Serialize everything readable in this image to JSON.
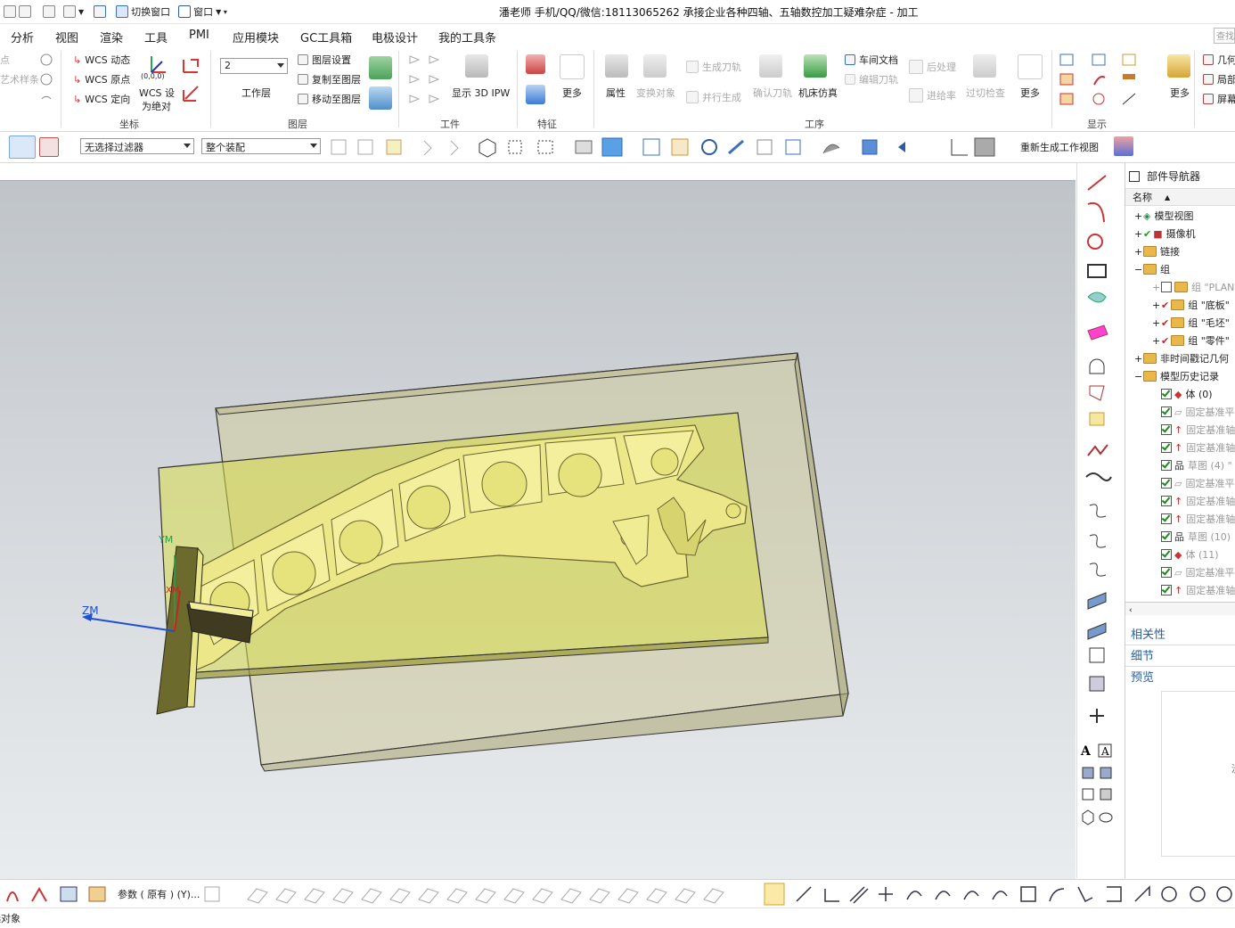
{
  "window": {
    "title": "潘老师 手机/QQ/微信:18113065262 承接企业各种四轴、五轴数控加工疑难杂症 - 加工"
  },
  "quick_access": {
    "switch_window": "切换窗口",
    "window": "窗口"
  },
  "menu": {
    "tabs": [
      "分析",
      "视图",
      "渲染",
      "工具",
      "PMI",
      "应用模块",
      "GC工具箱",
      "电极设计",
      "我的工具条"
    ],
    "search_placeholder": "查找"
  },
  "ribbon": {
    "left_cut": {
      "line1": "点",
      "line2": "艺术样条"
    },
    "coord": {
      "wcs_dynamic": "WCS 动态",
      "wcs_origin": "WCS 原点",
      "wcs_orient": "WCS 定向",
      "wcs_set_abs_1": "WCS 设",
      "wcs_set_abs_2": "为绝对",
      "origin_tag": "(0,0,0)",
      "group_label": "坐标"
    },
    "layer": {
      "work_layer_value": "2",
      "work_layer_label": "工作层",
      "layer_settings": "图层设置",
      "copy_to_layer": "复制至图层",
      "move_to_layer": "移动至图层",
      "group_label": "图层"
    },
    "workpiece": {
      "show_3d_ipw": "显示 3D IPW",
      "group_label": "工件"
    },
    "feature": {
      "more": "更多",
      "group_label": "特征"
    },
    "operation": {
      "properties": "属性",
      "transform": "变换对象",
      "generate_toolpath": "生成刀轨",
      "parallel_generate": "并行生成",
      "confirm_toolpath": "确认刀轨",
      "machine_sim": "机床仿真",
      "shop_doc": "车间文档",
      "edit_toolpath": "编辑刀轨",
      "postprocess": "后处理",
      "list_toolpath": "进给率",
      "overcut_check": "过切检查",
      "more": "更多",
      "group_label": "工序"
    },
    "display": {
      "more": "更多",
      "group_label": "显示"
    },
    "right_cut": {
      "line1": "几何",
      "line2": "局部",
      "line3": "屏幕"
    }
  },
  "toolbar2": {
    "selection_filter": "无选择过滤器",
    "scope": "整个装配",
    "regen_work_view": "重新生成工作视图"
  },
  "viewport": {
    "axis_zm": "ZM",
    "axis_ym": "YM",
    "axis_xm": "XM"
  },
  "navigator": {
    "title": "部件导航器",
    "column_name": "名称",
    "items": [
      {
        "label": "模型视图",
        "dim": false
      },
      {
        "label": "摄像机",
        "dim": false
      },
      {
        "label": "链接",
        "dim": false
      },
      {
        "label": "组",
        "dim": false
      },
      {
        "label": "组 \"PLAN",
        "dim": true
      },
      {
        "label": "组 \"底板\"",
        "dim": false
      },
      {
        "label": "组 \"毛坯\"",
        "dim": false
      },
      {
        "label": "组 \"零件\"",
        "dim": false
      },
      {
        "label": "非时间戳记几何",
        "dim": false
      },
      {
        "label": "模型历史记录",
        "dim": false
      },
      {
        "label": "体 (0)",
        "dim": false
      },
      {
        "label": "固定基准平",
        "dim": true
      },
      {
        "label": "固定基准轴",
        "dim": true
      },
      {
        "label": "固定基准轴",
        "dim": true
      },
      {
        "label": "草图 (4) \"",
        "dim": true
      },
      {
        "label": "固定基准平",
        "dim": true
      },
      {
        "label": "固定基准轴",
        "dim": true
      },
      {
        "label": "固定基准轴",
        "dim": true
      },
      {
        "label": "草图 (10)",
        "dim": true
      },
      {
        "label": "体 (11)",
        "dim": true
      },
      {
        "label": "固定基准平",
        "dim": true
      },
      {
        "label": "固定基准轴",
        "dim": true
      }
    ],
    "sections": [
      "相关性",
      "细节",
      "预览"
    ],
    "preview_cut": "没"
  },
  "bottombar": {
    "params_label": "参数 ( 原有 ) (Y)..."
  },
  "status": {
    "text": "选对象"
  },
  "colors": {
    "part_yellow": "#e9e27a",
    "stock_translucent": "#c9d35a",
    "base_plate": "#c8c49a",
    "axis_blue": "#1f4fd1",
    "axis_red": "#d02020",
    "nav_blue": "#2a5d9f"
  }
}
